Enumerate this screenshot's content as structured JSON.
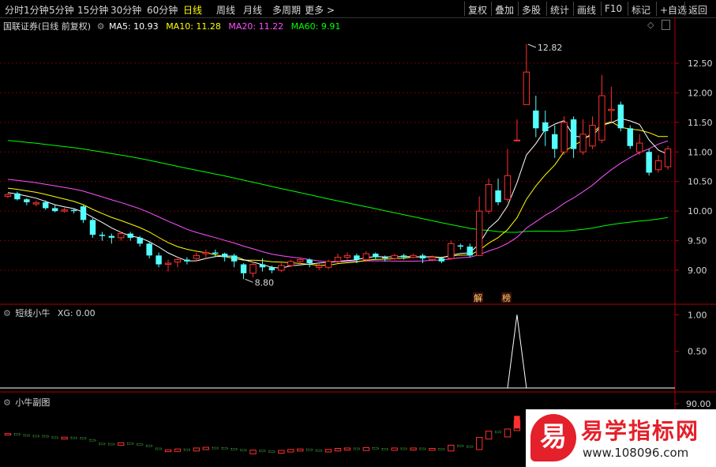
{
  "toolbar": {
    "periods": [
      "分时",
      "1分钟",
      "5分钟",
      "15分钟",
      "30分钟",
      "60分钟",
      "日线",
      "周线",
      "月线",
      "多周期",
      "更多 >"
    ],
    "active_period": "日线",
    "actions": [
      "复权",
      "叠加",
      "多股",
      "统计",
      "画线",
      "F10",
      "标记",
      "+自选",
      "返回"
    ]
  },
  "main_panel": {
    "title": "国联证券(日线 前复权)",
    "ma5": "MA5: 10.93",
    "ma10": "MA10: 11.28",
    "ma20": "MA20: 11.22",
    "ma60": "MA60: 9.91",
    "high_label": "12.82",
    "low_label": "8.80",
    "tag_jie": "解",
    "tag_bang": "榜",
    "y_ticks": [
      "12.50",
      "12.00",
      "11.50",
      "11.00",
      "10.50",
      "10.00",
      "9.50",
      "9.00"
    ]
  },
  "xg_panel": {
    "title": "短线小牛",
    "xg": "XG: 0.00",
    "y_ticks": [
      "1.00",
      "0.50"
    ]
  },
  "sub_panel": {
    "title": "小牛副图",
    "y_ticks": [
      "90.00"
    ]
  },
  "watermark": {
    "brand": "易学指标网",
    "url": "www.108096.com",
    "logo_char": "易"
  },
  "colors": {
    "up": "#ff3030",
    "down": "#54ffff",
    "ma5": "#ffffff",
    "ma10": "#ffff00",
    "ma20": "#ff50ff",
    "ma60": "#00ff00"
  },
  "chart_data": {
    "type": "candlestick",
    "y_range": [
      8.6,
      12.9
    ],
    "candles": [
      [
        10.25,
        10.28,
        10.3,
        10.22
      ],
      [
        10.3,
        10.2,
        10.33,
        10.18
      ],
      [
        10.2,
        10.15,
        10.22,
        10.1
      ],
      [
        10.12,
        10.14,
        10.18,
        10.08
      ],
      [
        10.15,
        10.05,
        10.18,
        10.02
      ],
      [
        10.05,
        10.0,
        10.1,
        9.98
      ],
      [
        10.0,
        10.02,
        10.06,
        9.97
      ],
      [
        10.02,
        10.0,
        10.05,
        9.96
      ],
      [
        10.08,
        9.85,
        10.1,
        9.8
      ],
      [
        9.85,
        9.6,
        9.88,
        9.55
      ],
      [
        9.6,
        9.58,
        9.65,
        9.5
      ],
      [
        9.58,
        9.55,
        9.62,
        9.45
      ],
      [
        9.55,
        9.62,
        9.65,
        9.5
      ],
      [
        9.62,
        9.55,
        9.65,
        9.5
      ],
      [
        9.55,
        9.45,
        9.58,
        9.4
      ],
      [
        9.45,
        9.25,
        9.48,
        9.2
      ],
      [
        9.25,
        9.1,
        9.3,
        9.05
      ],
      [
        9.1,
        9.12,
        9.18,
        8.98
      ],
      [
        9.14,
        9.18,
        9.2,
        9.05
      ],
      [
        9.18,
        9.15,
        9.22,
        9.1
      ],
      [
        9.2,
        9.25,
        9.3,
        9.15
      ],
      [
        9.28,
        9.3,
        9.35,
        9.2
      ],
      [
        9.3,
        9.28,
        9.35,
        9.22
      ],
      [
        9.28,
        9.22,
        9.3,
        9.15
      ],
      [
        9.25,
        9.15,
        9.28,
        9.05
      ],
      [
        9.1,
        8.95,
        9.12,
        8.85
      ],
      [
        8.95,
        9.1,
        9.15,
        8.88
      ],
      [
        9.1,
        9.05,
        9.2,
        8.98
      ],
      [
        9.05,
        9.0,
        9.08,
        8.95
      ],
      [
        9.0,
        9.08,
        9.12,
        8.97
      ],
      [
        9.08,
        9.15,
        9.18,
        9.05
      ],
      [
        9.15,
        9.18,
        9.22,
        9.1
      ],
      [
        9.18,
        9.12,
        9.2,
        9.05
      ],
      [
        9.05,
        9.08,
        9.12,
        9.0
      ],
      [
        9.05,
        9.15,
        9.18,
        9.02
      ],
      [
        9.15,
        9.22,
        9.28,
        9.12
      ],
      [
        9.22,
        9.25,
        9.3,
        9.18
      ],
      [
        9.25,
        9.18,
        9.28,
        9.12
      ],
      [
        9.18,
        9.28,
        9.32,
        9.15
      ],
      [
        9.28,
        9.22,
        9.3,
        9.18
      ],
      [
        9.22,
        9.2,
        9.25,
        9.15
      ],
      [
        9.2,
        9.25,
        9.28,
        9.18
      ],
      [
        9.25,
        9.22,
        9.28,
        9.18
      ],
      [
        9.22,
        9.25,
        9.28,
        9.2
      ],
      [
        9.25,
        9.2,
        9.28,
        9.12
      ],
      [
        9.18,
        9.22,
        9.25,
        9.15
      ],
      [
        9.2,
        9.15,
        9.23,
        9.12
      ],
      [
        9.2,
        9.45,
        9.5,
        9.18
      ],
      [
        9.42,
        9.4,
        9.45,
        9.35
      ],
      [
        9.4,
        9.25,
        9.45,
        9.22
      ],
      [
        9.25,
        10.0,
        10.25,
        9.25
      ],
      [
        10.0,
        10.45,
        10.55,
        9.95
      ],
      [
        10.35,
        10.15,
        10.55,
        10.1
      ],
      [
        10.2,
        10.6,
        11.05,
        10.15
      ],
      [
        11.2,
        11.2,
        11.55,
        11.2
      ],
      [
        11.8,
        12.35,
        12.82,
        11.8
      ],
      [
        11.7,
        11.4,
        11.95,
        11.25
      ],
      [
        11.5,
        11.35,
        11.7,
        11.1
      ],
      [
        11.3,
        11.05,
        11.45,
        10.9
      ],
      [
        11.0,
        11.5,
        11.6,
        10.95
      ],
      [
        11.55,
        11.05,
        11.6,
        10.9
      ],
      [
        11.0,
        11.3,
        11.55,
        10.95
      ],
      [
        11.1,
        11.45,
        11.6,
        11.05
      ],
      [
        11.2,
        11.95,
        12.3,
        11.15
      ],
      [
        11.7,
        11.72,
        12.1,
        11.5
      ],
      [
        11.8,
        11.4,
        11.85,
        11.35
      ],
      [
        11.4,
        11.1,
        11.45,
        11.05
      ],
      [
        11.0,
        11.15,
        11.3,
        10.95
      ],
      [
        11.0,
        10.65,
        11.05,
        10.6
      ],
      [
        10.7,
        10.85,
        10.95,
        10.65
      ],
      [
        10.75,
        11.05,
        11.1,
        10.7
      ]
    ],
    "xg_spike": {
      "index": 54,
      "value": 1.0,
      "xg_range": [
        0,
        1.1
      ]
    },
    "sub_range": [
      0,
      100
    ]
  }
}
